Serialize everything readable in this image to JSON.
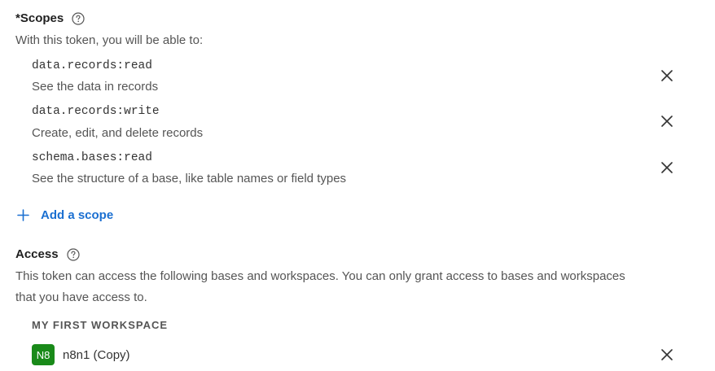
{
  "scopes": {
    "required_marker": "*",
    "title": "Scopes",
    "description": "With this token, you will be able to:",
    "items": [
      {
        "code": "data.records:read",
        "description": "See the data in records"
      },
      {
        "code": "data.records:write",
        "description": "Create, edit, and delete records"
      },
      {
        "code": "schema.bases:read",
        "description": "See the structure of a base, like table names or field types"
      }
    ],
    "add_label": "Add a scope"
  },
  "access": {
    "title": "Access",
    "description_line1": "This token can access the following bases and workspaces. You can only grant access to bases and workspaces",
    "description_line2": "that you have access to.",
    "workspace": {
      "label": "MY FIRST WORKSPACE",
      "bases": [
        {
          "badge": "N8",
          "name": "n8n1 (Copy)",
          "badge_color": "#198a19"
        }
      ]
    }
  },
  "colors": {
    "accent": "#1a6fd1",
    "badge_green": "#198a19"
  }
}
